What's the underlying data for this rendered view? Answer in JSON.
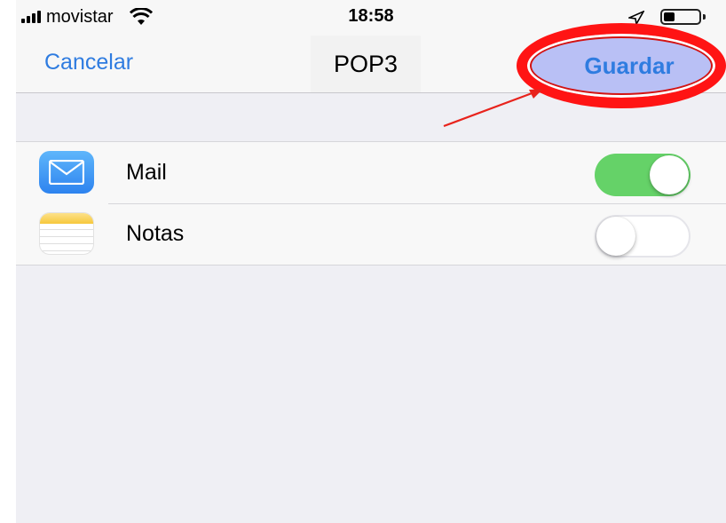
{
  "status_bar": {
    "carrier": "movistar",
    "time": "18:58"
  },
  "nav": {
    "cancel_label": "Cancelar",
    "title": "POP3",
    "save_label": "Guardar"
  },
  "settings": {
    "items": [
      {
        "label": "Mail",
        "icon": "mail-icon",
        "enabled": true
      },
      {
        "label": "Notas",
        "icon": "notes-icon",
        "enabled": false
      }
    ]
  },
  "colors": {
    "accent": "#2f7ce0",
    "toggle_on": "#65d268",
    "annotation": "#ff1414",
    "highlight_fill": "#b9c0f5"
  }
}
